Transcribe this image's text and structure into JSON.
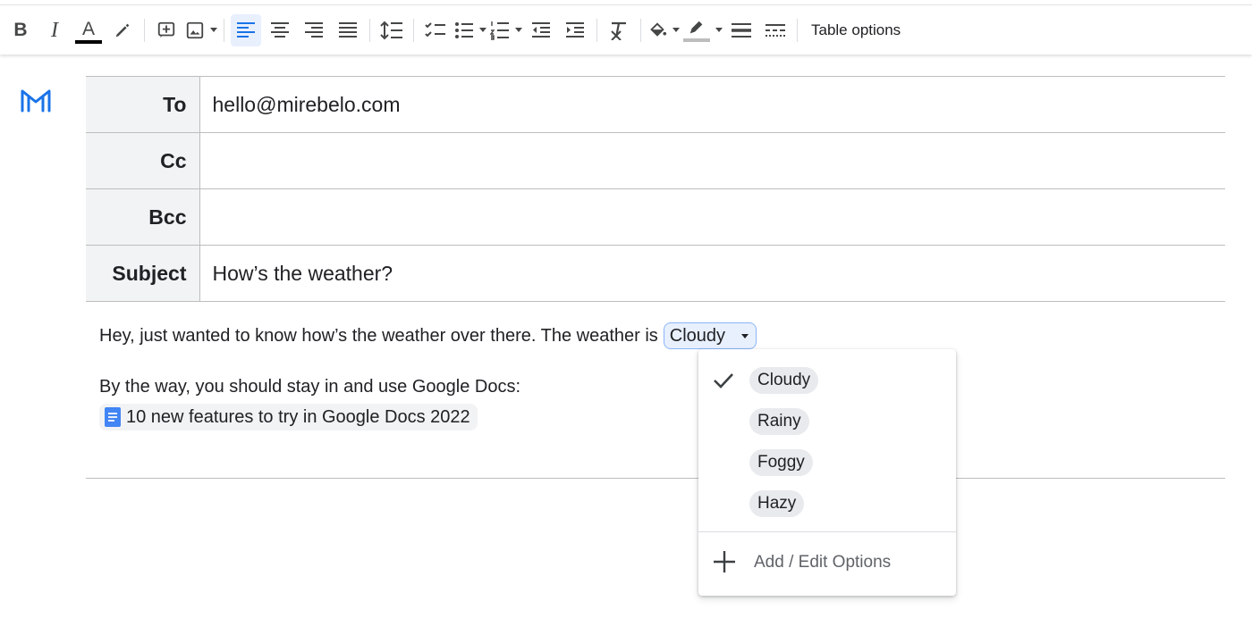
{
  "toolbar": {
    "bold": "B",
    "italic": "I",
    "text_color": "A",
    "table_options": "Table options"
  },
  "header": {
    "to_label": "To",
    "to_value": "hello@mirebelo.com",
    "cc_label": "Cc",
    "cc_value": "",
    "bcc_label": "Bcc",
    "bcc_value": "",
    "subject_label": "Subject",
    "subject_value": "How’s the weather?"
  },
  "body": {
    "line1": "Hey, just wanted to know how’s the weather over there. The weather is",
    "weather_selected": "Cloudy",
    "line2": "By the way, you should stay in and use Google Docs:",
    "doc_link": "10 new features to try in Google Docs 2022"
  },
  "dropdown": {
    "options": [
      "Cloudy",
      "Rainy",
      "Foggy",
      "Hazy"
    ],
    "selected": "Cloudy",
    "add_edit_label": "Add / Edit Options"
  },
  "colors": {
    "accent_blue": "#1a73e8",
    "chip_bg": "#e8f0fe",
    "doc_icon": "#4285f4",
    "label_bg": "#f1f3f4"
  }
}
